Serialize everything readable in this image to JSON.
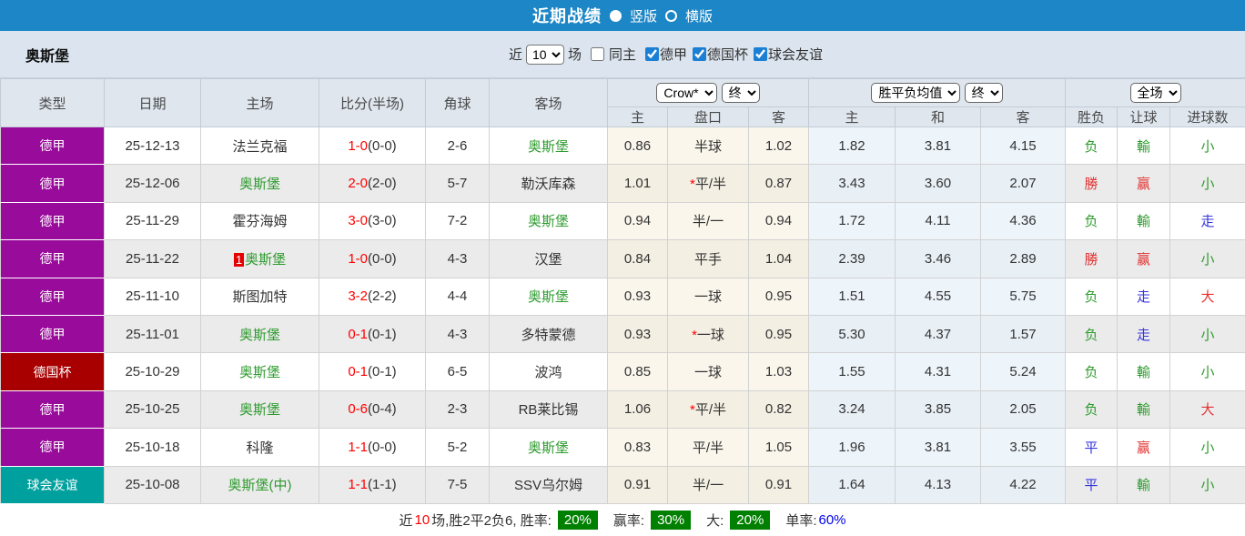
{
  "colors": {
    "topbar": "#1c86c6",
    "filter_bg": "#dce5ef",
    "header_bg": "#dfe6ee",
    "bundesliga": "#990b9b",
    "german_cup": "#a80000",
    "club_friendly": "#00a09e",
    "team_green": "#2e9b2e",
    "win_red": "#e23333",
    "draw_blue": "#3535e0",
    "lose_green": "#2e9b2e",
    "score_red": "#ff0000",
    "pct_badge_green": "#008000",
    "single_rate_blue": "#0000ee"
  },
  "topbar": {
    "title": "近期战绩",
    "radio_vertical": "竖版",
    "radio_horizontal": "横版"
  },
  "filter": {
    "team": "奥斯堡",
    "near_label": "近",
    "games_value": "10",
    "games_suffix": "场",
    "same_home_label": "同主",
    "same_home_checked": false,
    "leagues": [
      {
        "label": "德甲",
        "checked": true
      },
      {
        "label": "德国杯",
        "checked": true
      },
      {
        "label": "球会友谊",
        "checked": true
      }
    ]
  },
  "table": {
    "header": {
      "col_type": "类型",
      "col_date": "日期",
      "col_home": "主场",
      "col_score": "比分(半场)",
      "col_corner": "角球",
      "col_away": "客场",
      "ah_company_select": "Crow*",
      "ah_stage_select": "终",
      "odds_type_select": "胜平负均值",
      "odds_stage_select": "终",
      "scope_select": "全场",
      "sub": [
        "主",
        "盘口",
        "客",
        "主",
        "和",
        "客",
        "胜负",
        "让球",
        "进球数"
      ]
    },
    "rows": [
      {
        "league": "德甲",
        "league_color": "#990b9b",
        "date": "25-12-13",
        "home": "法兰克福",
        "home_green": false,
        "home_badge": "",
        "score_ft": "1-0",
        "score_ht": "(0-0)",
        "corners": "2-6",
        "away": "奥斯堡",
        "away_green": true,
        "ah_home": "0.86",
        "ah_star": false,
        "ah_line": "半球",
        "ah_away": "1.02",
        "odds_home": "1.82",
        "odds_draw": "3.81",
        "odds_away": "4.15",
        "result": {
          "text": "负",
          "color": "green"
        },
        "handicap": {
          "text": "輸",
          "color": "green"
        },
        "goals": {
          "text": "小",
          "color": "green"
        }
      },
      {
        "league": "德甲",
        "league_color": "#990b9b",
        "date": "25-12-06",
        "home": "奥斯堡",
        "home_green": true,
        "home_badge": "",
        "score_ft": "2-0",
        "score_ht": "(2-0)",
        "corners": "5-7",
        "away": "勒沃库森",
        "away_green": false,
        "ah_home": "1.01",
        "ah_star": true,
        "ah_line": "平/半",
        "ah_away": "0.87",
        "odds_home": "3.43",
        "odds_draw": "3.60",
        "odds_away": "2.07",
        "result": {
          "text": "勝",
          "color": "red"
        },
        "handicap": {
          "text": "赢",
          "color": "red"
        },
        "goals": {
          "text": "小",
          "color": "green"
        }
      },
      {
        "league": "德甲",
        "league_color": "#990b9b",
        "date": "25-11-29",
        "home": "霍芬海姆",
        "home_green": false,
        "home_badge": "",
        "score_ft": "3-0",
        "score_ht": "(3-0)",
        "corners": "7-2",
        "away": "奥斯堡",
        "away_green": true,
        "ah_home": "0.94",
        "ah_star": false,
        "ah_line": "半/一",
        "ah_away": "0.94",
        "odds_home": "1.72",
        "odds_draw": "4.11",
        "odds_away": "4.36",
        "result": {
          "text": "负",
          "color": "green"
        },
        "handicap": {
          "text": "輸",
          "color": "green"
        },
        "goals": {
          "text": "走",
          "color": "blue"
        }
      },
      {
        "league": "德甲",
        "league_color": "#990b9b",
        "date": "25-11-22",
        "home": "奥斯堡",
        "home_green": true,
        "home_badge": "1",
        "score_ft": "1-0",
        "score_ht": "(0-0)",
        "corners": "4-3",
        "away": "汉堡",
        "away_green": false,
        "ah_home": "0.84",
        "ah_star": false,
        "ah_line": "平手",
        "ah_away": "1.04",
        "odds_home": "2.39",
        "odds_draw": "3.46",
        "odds_away": "2.89",
        "result": {
          "text": "勝",
          "color": "red"
        },
        "handicap": {
          "text": "赢",
          "color": "red"
        },
        "goals": {
          "text": "小",
          "color": "green"
        }
      },
      {
        "league": "德甲",
        "league_color": "#990b9b",
        "date": "25-11-10",
        "home": "斯图加特",
        "home_green": false,
        "home_badge": "",
        "score_ft": "3-2",
        "score_ht": "(2-2)",
        "corners": "4-4",
        "away": "奥斯堡",
        "away_green": true,
        "ah_home": "0.93",
        "ah_star": false,
        "ah_line": "一球",
        "ah_away": "0.95",
        "odds_home": "1.51",
        "odds_draw": "4.55",
        "odds_away": "5.75",
        "result": {
          "text": "负",
          "color": "green"
        },
        "handicap": {
          "text": "走",
          "color": "blue"
        },
        "goals": {
          "text": "大",
          "color": "red"
        }
      },
      {
        "league": "德甲",
        "league_color": "#990b9b",
        "date": "25-11-01",
        "home": "奥斯堡",
        "home_green": true,
        "home_badge": "",
        "score_ft": "0-1",
        "score_ht": "(0-1)",
        "corners": "4-3",
        "away": "多特蒙德",
        "away_green": false,
        "ah_home": "0.93",
        "ah_star": true,
        "ah_line": "一球",
        "ah_away": "0.95",
        "odds_home": "5.30",
        "odds_draw": "4.37",
        "odds_away": "1.57",
        "result": {
          "text": "负",
          "color": "green"
        },
        "handicap": {
          "text": "走",
          "color": "blue"
        },
        "goals": {
          "text": "小",
          "color": "green"
        }
      },
      {
        "league": "德国杯",
        "league_color": "#a80000",
        "date": "25-10-29",
        "home": "奥斯堡",
        "home_green": true,
        "home_badge": "",
        "score_ft": "0-1",
        "score_ht": "(0-1)",
        "corners": "6-5",
        "away": "波鸿",
        "away_green": false,
        "ah_home": "0.85",
        "ah_star": false,
        "ah_line": "一球",
        "ah_away": "1.03",
        "odds_home": "1.55",
        "odds_draw": "4.31",
        "odds_away": "5.24",
        "result": {
          "text": "负",
          "color": "green"
        },
        "handicap": {
          "text": "輸",
          "color": "green"
        },
        "goals": {
          "text": "小",
          "color": "green"
        }
      },
      {
        "league": "德甲",
        "league_color": "#990b9b",
        "date": "25-10-25",
        "home": "奥斯堡",
        "home_green": true,
        "home_badge": "",
        "score_ft": "0-6",
        "score_ht": "(0-4)",
        "corners": "2-3",
        "away": "RB莱比锡",
        "away_green": false,
        "ah_home": "1.06",
        "ah_star": true,
        "ah_line": "平/半",
        "ah_away": "0.82",
        "odds_home": "3.24",
        "odds_draw": "3.85",
        "odds_away": "2.05",
        "result": {
          "text": "负",
          "color": "green"
        },
        "handicap": {
          "text": "輸",
          "color": "green"
        },
        "goals": {
          "text": "大",
          "color": "red"
        }
      },
      {
        "league": "德甲",
        "league_color": "#990b9b",
        "date": "25-10-18",
        "home": "科隆",
        "home_green": false,
        "home_badge": "",
        "score_ft": "1-1",
        "score_ht": "(0-0)",
        "corners": "5-2",
        "away": "奥斯堡",
        "away_green": true,
        "ah_home": "0.83",
        "ah_star": false,
        "ah_line": "平/半",
        "ah_away": "1.05",
        "odds_home": "1.96",
        "odds_draw": "3.81",
        "odds_away": "3.55",
        "result": {
          "text": "平",
          "color": "blue"
        },
        "handicap": {
          "text": "赢",
          "color": "red"
        },
        "goals": {
          "text": "小",
          "color": "green"
        }
      },
      {
        "league": "球会友谊",
        "league_color": "#00a09e",
        "date": "25-10-08",
        "home": "奥斯堡(中)",
        "home_green": true,
        "home_badge": "",
        "score_ft": "1-1",
        "score_ht": "(1-1)",
        "corners": "7-5",
        "away": "SSV乌尔姆",
        "away_green": false,
        "ah_home": "0.91",
        "ah_star": false,
        "ah_line": "半/一",
        "ah_away": "0.91",
        "odds_home": "1.64",
        "odds_draw": "4.13",
        "odds_away": "4.22",
        "result": {
          "text": "平",
          "color": "blue"
        },
        "handicap": {
          "text": "輸",
          "color": "green"
        },
        "goals": {
          "text": "小",
          "color": "green"
        }
      }
    ]
  },
  "footer": {
    "near_label": "近",
    "games": "10",
    "summary": "场,胜2平2负6, 胜率:",
    "win_rate_pct": "20%",
    "handicap_label": "赢率:",
    "handicap_pct": "30%",
    "big_label": "大:",
    "big_pct": "20%",
    "single_label": "单率:",
    "single_pct": "60%"
  }
}
